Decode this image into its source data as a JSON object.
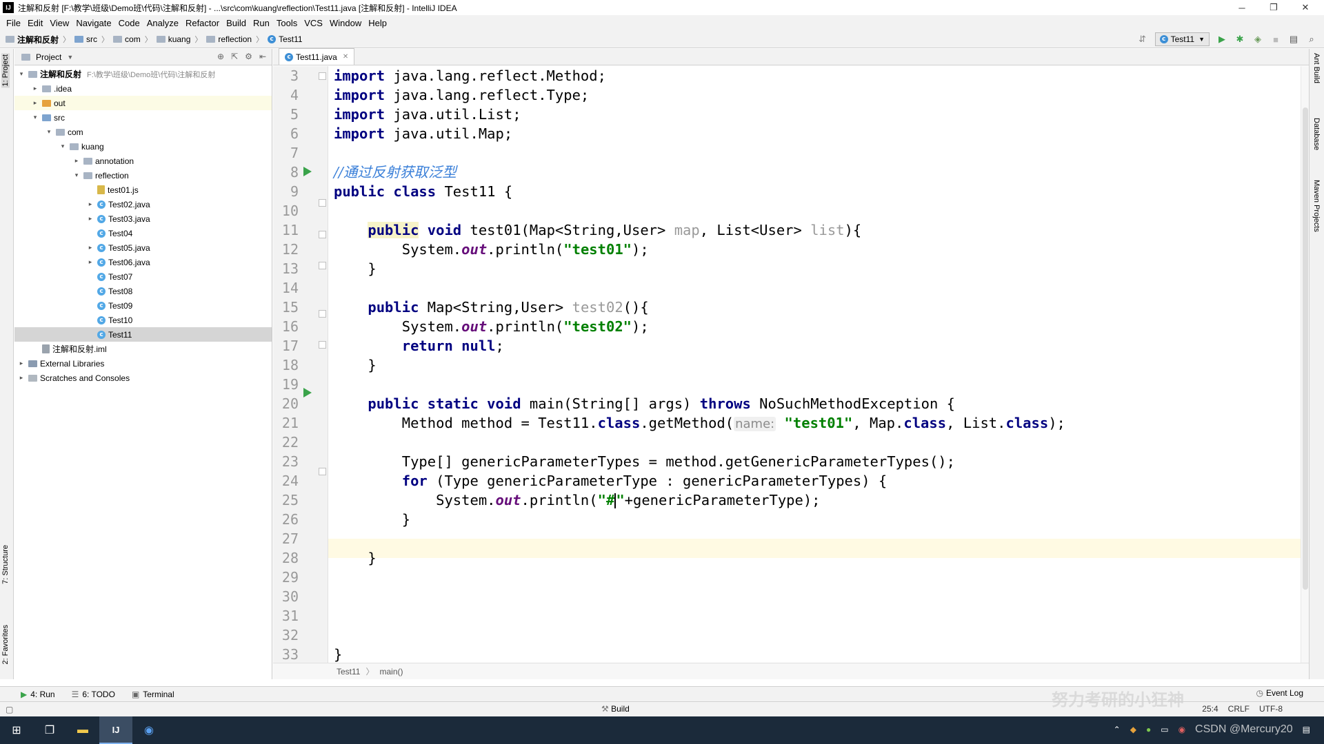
{
  "window": {
    "title": "注解和反射 [F:\\教学\\班级\\Demo班\\代码\\注解和反射] - ...\\src\\com\\kuang\\reflection\\Test11.java [注解和反射] - IntelliJ IDEA",
    "minimize": "─",
    "maximize": "❐",
    "close": "✕"
  },
  "menu": [
    "File",
    "Edit",
    "View",
    "Navigate",
    "Code",
    "Analyze",
    "Refactor",
    "Build",
    "Run",
    "Tools",
    "VCS",
    "Window",
    "Help"
  ],
  "breadcrumb": [
    "注解和反射",
    "src",
    "com",
    "kuang",
    "reflection",
    "Test11"
  ],
  "run_config": "Test11",
  "left_strip": {
    "project": "1: Project",
    "structure": "7: Structure",
    "favorites": "2: Favorites"
  },
  "right_strip": {
    "ant": "Ant Build",
    "database": "Database",
    "maven": "Maven Projects"
  },
  "project_panel": {
    "header": "Project",
    "tree": [
      {
        "label": "注解和反射",
        "path": "F:\\教学\\班级\\Demo班\\代码\\注解和反射",
        "icon": "module-icon",
        "arrow": "▾",
        "indent": 0
      },
      {
        "label": ".idea",
        "icon": "folder-icon",
        "arrow": "▸",
        "indent": 1
      },
      {
        "label": "out",
        "icon": "folder-orange-icon",
        "arrow": "▸",
        "indent": 1
      },
      {
        "label": "src",
        "icon": "folder-blue-icon",
        "arrow": "▾",
        "indent": 1
      },
      {
        "label": "com",
        "icon": "package-icon",
        "arrow": "▾",
        "indent": 2
      },
      {
        "label": "kuang",
        "icon": "package-icon",
        "arrow": "▾",
        "indent": 3
      },
      {
        "label": "annotation",
        "icon": "package-icon",
        "arrow": "▸",
        "indent": 4
      },
      {
        "label": "reflection",
        "icon": "package-icon",
        "arrow": "▾",
        "indent": 4
      },
      {
        "label": "test01.js",
        "icon": "js-file-icon",
        "arrow": "",
        "indent": 5
      },
      {
        "label": "Test02.java",
        "icon": "class-icon",
        "arrow": "▸",
        "indent": 5
      },
      {
        "label": "Test03.java",
        "icon": "class-icon",
        "arrow": "▸",
        "indent": 5
      },
      {
        "label": "Test04",
        "icon": "class-icon",
        "arrow": "",
        "indent": 5
      },
      {
        "label": "Test05.java",
        "icon": "class-icon",
        "arrow": "▸",
        "indent": 5
      },
      {
        "label": "Test06.java",
        "icon": "class-icon",
        "arrow": "▸",
        "indent": 5
      },
      {
        "label": "Test07",
        "icon": "class-icon",
        "arrow": "",
        "indent": 5
      },
      {
        "label": "Test08",
        "icon": "class-icon",
        "arrow": "",
        "indent": 5
      },
      {
        "label": "Test09",
        "icon": "class-icon",
        "arrow": "",
        "indent": 5
      },
      {
        "label": "Test10",
        "icon": "class-icon",
        "arrow": "",
        "indent": 5
      },
      {
        "label": "Test11",
        "icon": "class-icon",
        "arrow": "",
        "indent": 5
      },
      {
        "label": "注解和反射.iml",
        "icon": "iml-file-icon",
        "arrow": "",
        "indent": 1
      },
      {
        "label": "External Libraries",
        "icon": "library-icon",
        "arrow": "▸",
        "indent": 0
      },
      {
        "label": "Scratches and Consoles",
        "icon": "scratch-icon",
        "arrow": "▸",
        "indent": 0
      }
    ]
  },
  "editor": {
    "tab": "Test11.java",
    "line_numbers": [
      "3",
      "4",
      "5",
      "6",
      "7",
      "8",
      "9",
      "10",
      "11",
      "12",
      "13",
      "14",
      "15",
      "16",
      "17",
      "18",
      "19",
      "20",
      "21",
      "22",
      "23",
      "24",
      "25",
      "26",
      "27",
      "28",
      "29",
      "30",
      "31",
      "32",
      "33"
    ],
    "breadcrumb": [
      "Test11",
      "main()"
    ],
    "code": {
      "l3_kw": "import",
      "l3_rest": " java.lang.reflect.Method;",
      "l4_kw": "import",
      "l4_rest": " java.lang.reflect.Type;",
      "l5_kw": "import",
      "l5_rest": " java.util.List;",
      "l6_kw": "import",
      "l6_rest": " java.util.Map;",
      "l8_comment": "//通过反射获取泛型",
      "l9_kw": "public class",
      "l9_rest": " Test11 {",
      "l11_indent": "    ",
      "l11_kw1": "public",
      "l11_kw2": " void",
      "l11_a": " test01(Map<String,User> ",
      "l11_p1": "map",
      "l11_b": ", List<User> ",
      "l11_p2": "list",
      "l11_c": "){",
      "l12_a": "        System.",
      "l12_out": "out",
      "l12_b": ".println(",
      "l12_str": "\"test01\"",
      "l12_c": ");",
      "l13": "    }",
      "l15_indent": "    ",
      "l15_kw": "public",
      "l15_a": " Map<String,User> ",
      "l15_m": "test02",
      "l15_b": "(){",
      "l16_a": "        System.",
      "l16_out": "out",
      "l16_b": ".println(",
      "l16_str": "\"test02\"",
      "l16_c": ");",
      "l17_indent": "        ",
      "l17_kw": "return null",
      "l17_rest": ";",
      "l18": "    }",
      "l20_indent": "    ",
      "l20_kw": "public static void",
      "l20_a": " main(String[] args) ",
      "l20_kw2": "throws",
      "l20_b": " NoSuchMethodException {",
      "l21_a": "        Method method = Test11.",
      "l21_kw1": "class",
      "l21_b": ".getMethod(",
      "l21_hint": "name:",
      "l21_str": " \"test01\"",
      "l21_c": ", Map.",
      "l21_kw2": "class",
      "l21_d": ", List.",
      "l21_kw3": "class",
      "l21_e": ");",
      "l23": "        Type[] genericParameterTypes = method.getGenericParameterTypes();",
      "l24_indent": "        ",
      "l24_kw": "for",
      "l24_rest": " (Type genericParameterType : genericParameterTypes) {",
      "l25_a": "            System.",
      "l25_out": "out",
      "l25_b": ".println(",
      "l25_s1": "\"#",
      "l25_s2": "\"",
      "l25_c": "+genericParameterType);",
      "l26": "        }",
      "l28": "    }",
      "l33": "}"
    }
  },
  "bottom_tabs": {
    "run": "4: Run",
    "todo": "6: TODO",
    "terminal": "Terminal",
    "event_log": "Event Log"
  },
  "status": {
    "build": "Build",
    "position": "25:4",
    "line_sep": "CRLF",
    "encoding": "UTF-8"
  },
  "watermark": {
    "main": "努力考研的小狂神",
    "csdn": "CSDN @Mercury20"
  },
  "colors": {
    "keyword": "#000080",
    "string": "#008000",
    "comment": "#3a7fd8",
    "static_field": "#660e7a",
    "run_marker": "#3aa34a"
  }
}
